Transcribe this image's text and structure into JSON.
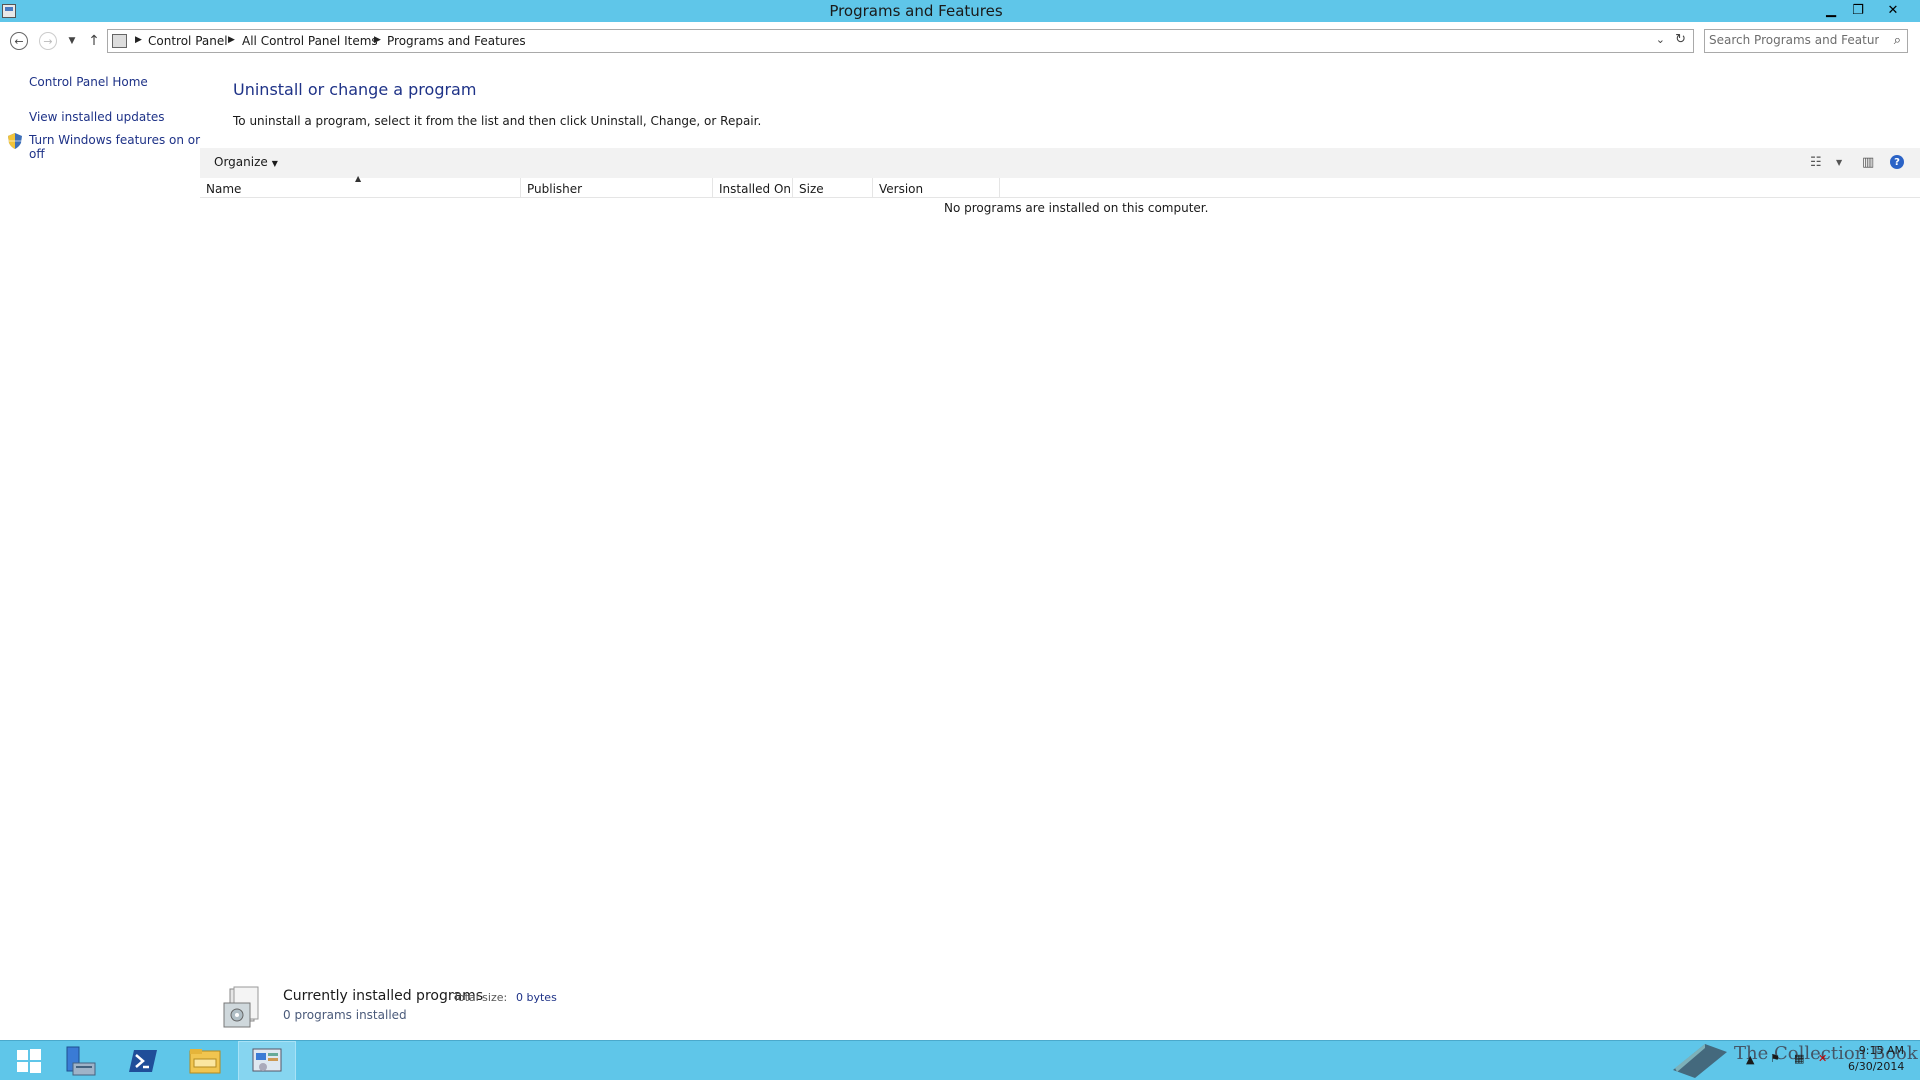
{
  "window": {
    "title": "Programs and Features",
    "controls": {
      "minimize": "▁",
      "restore": "❐",
      "close": "✕"
    }
  },
  "address": {
    "breadcrumb": [
      "Control Panel",
      "All Control Panel Items",
      "Programs and Features"
    ],
    "search_placeholder": "Search Programs and Features"
  },
  "sidebar": {
    "items": [
      {
        "label": "Control Panel Home"
      },
      {
        "label": "View installed updates"
      },
      {
        "label": "Turn Windows features on or",
        "label2": "off",
        "icon": "shield-icon"
      }
    ]
  },
  "main": {
    "title": "Uninstall or change a program",
    "description": "To uninstall a program, select it from the list and then click Uninstall, Change, or Repair.",
    "toolbar": {
      "organize": "Organize"
    },
    "columns": [
      "Name",
      "Publisher",
      "Installed On",
      "Size",
      "Version"
    ],
    "empty_message": "No programs are installed on this computer."
  },
  "details": {
    "title": "Currently installed programs",
    "total_size_label": "Total size:",
    "total_size_value": "0 bytes",
    "count": "0 programs installed"
  },
  "taskbar": {
    "apps": [
      "start-icon",
      "server-manager-icon",
      "powershell-icon",
      "file-explorer-icon",
      "control-panel-icon"
    ],
    "watermark": "The Collection Book",
    "time": "9:15 AM",
    "date": "6/30/2014"
  },
  "colors": {
    "accent": "#5fc6e9",
    "link": "#1e3287"
  }
}
